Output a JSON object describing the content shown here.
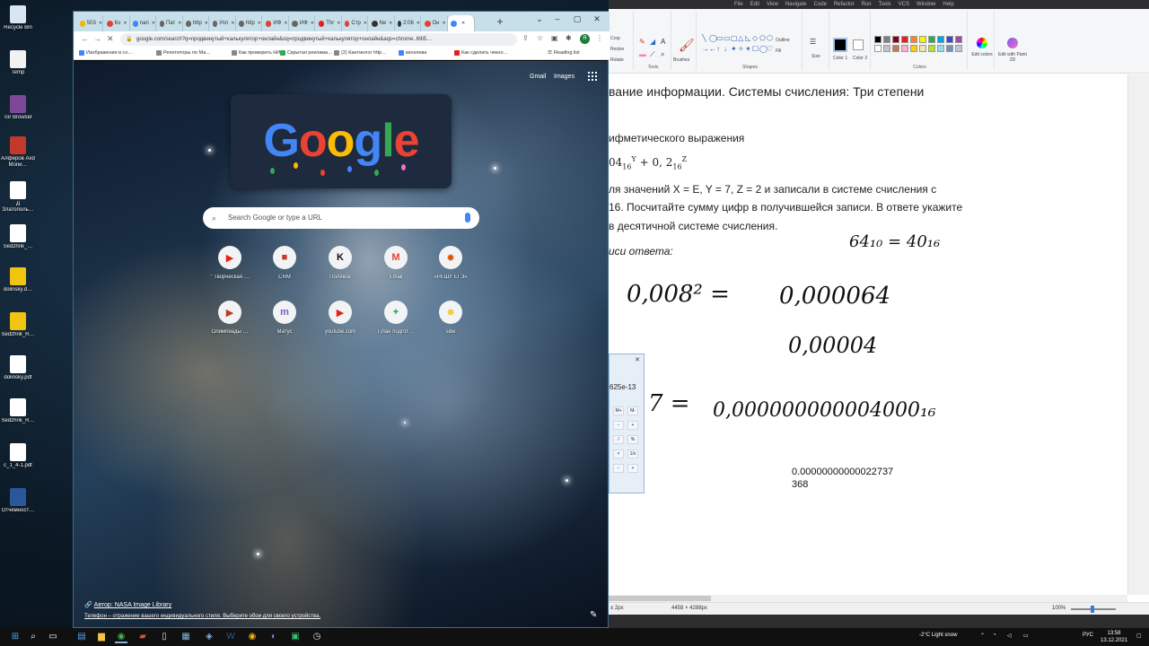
{
  "desktop": {
    "icons": [
      {
        "label": "Recycle Bin",
        "icon": "recycle-bin-icon",
        "color": "#d9e6f2"
      },
      {
        "label": "Temp",
        "icon": "text-file-icon",
        "color": "#f2f2f2"
      },
      {
        "label": "Tor Browser",
        "icon": "tor-icon",
        "color": "#7e4798"
      },
      {
        "label": "Алфёров Axd Monи…",
        "icon": "app-icon",
        "color": "#c0392b"
      },
      {
        "label": "Д Златополь…",
        "icon": "pdf-icon",
        "color": "#ffffff"
      },
      {
        "label": "Sedzhrik_…",
        "icon": "pdf-icon",
        "color": "#ffffff"
      },
      {
        "label": "dolinsky.d…",
        "icon": "text-file-icon",
        "color": "#f1c40f"
      },
      {
        "label": "Sedzhrik_R…",
        "icon": "text-file-icon",
        "color": "#f1c40f"
      },
      {
        "label": "dolinsky.pdf",
        "icon": "pdf-icon",
        "color": "#ffffff"
      },
      {
        "label": "Sedzhrik_R…",
        "icon": "pdf-icon",
        "color": "#ffffff"
      },
      {
        "label": "c_1_4-1.pdf",
        "icon": "pdf-icon",
        "color": "#ffffff"
      },
      {
        "label": "Отчёмност…",
        "icon": "word-icon",
        "color": "#2b579a"
      }
    ]
  },
  "chrome": {
    "tabs": [
      {
        "label": "503",
        "icon": "tab-favicon",
        "color": "#f4b400"
      },
      {
        "label": "Ко",
        "icon": "tab-favicon",
        "color": "#db4437"
      },
      {
        "label": "nan",
        "icon": "tab-favicon",
        "color": "#4285f4"
      },
      {
        "label": "Пат",
        "icon": "tab-favicon",
        "color": "#666666"
      },
      {
        "label": "http",
        "icon": "tab-favicon",
        "color": "#666666"
      },
      {
        "label": "Упл",
        "icon": "tab-favicon",
        "color": "#666666"
      },
      {
        "label": "http",
        "icon": "tab-favicon",
        "color": "#666666"
      },
      {
        "label": "ИФ",
        "icon": "tab-favicon",
        "color": "#db4437"
      },
      {
        "label": "ИФ",
        "icon": "tab-favicon",
        "color": "#666666"
      },
      {
        "label": "Thr",
        "icon": "tab-favicon",
        "color": "#e62117"
      },
      {
        "label": "Стр",
        "icon": "tab-favicon",
        "color": "#db4437"
      },
      {
        "label": "Ne",
        "icon": "tab-favicon",
        "color": "#333333"
      },
      {
        "label": "2:06",
        "icon": "tab-favicon",
        "color": "#333333"
      },
      {
        "label": "Он",
        "icon": "tab-favicon",
        "color": "#db4437"
      },
      {
        "label": "",
        "icon": "tab-favicon",
        "color": "#4285f4",
        "active": true
      }
    ],
    "url": "google.com/search?q=продвинутый+калькулятор+онлайн&oq=продвинутый+калькулятор+онлайн&aqs=chrome..69i5…",
    "bookmarks": [
      {
        "label": "Изображения в со…",
        "color": "#4285f4"
      },
      {
        "label": "Репетиторы по Ма…",
        "color": "#888888"
      },
      {
        "label": "Как проверить НИ…",
        "color": "#888888"
      },
      {
        "label": "Скрытая реклама…",
        "color": "#34a853"
      },
      {
        "label": "(2) Кантинлог http…",
        "color": "#888888"
      },
      {
        "label": "киселева",
        "color": "#4285f4"
      },
      {
        "label": "Как сделать чекно…",
        "color": "#e62117"
      }
    ],
    "reading_list": "Reading list",
    "ntp": {
      "gmail": "Gmail",
      "images": "Images",
      "doodle": {
        "letters": [
          "G",
          "o",
          "o",
          "g",
          "l",
          "e"
        ],
        "colors": [
          "#4285f4",
          "#ea4335",
          "#fbbc05",
          "#4285f4",
          "#34a853",
          "#ea4335"
        ]
      },
      "search_placeholder": "Search Google or type a URL",
      "shortcuts": [
        {
          "label": "\" Творческая …",
          "icon": "youtube-icon",
          "glyph": "▶",
          "color": "#e62117"
        },
        {
          "label": "CRM",
          "icon": "crm-icon",
          "glyph": "■",
          "color": "#c0392b"
        },
        {
          "label": "Полякое",
          "icon": "polyakov-icon",
          "glyph": "K",
          "color": "#111111"
        },
        {
          "label": "Email",
          "icon": "gmail-icon",
          "glyph": "M",
          "color": "#ea4335"
        },
        {
          "label": "«РЕШУ ЕГЭ»",
          "icon": "reshu-ege-icon",
          "glyph": "✹",
          "color": "#d35400"
        },
        {
          "label": "Олимпиады …",
          "icon": "olympiad-icon",
          "glyph": "▶",
          "color": "#c0392b"
        },
        {
          "label": "Матус",
          "icon": "matus-icon",
          "glyph": "m",
          "color": "#7b5fd0"
        },
        {
          "label": "youtube.com",
          "icon": "youtube-icon",
          "glyph": "▶",
          "color": "#e62117"
        },
        {
          "label": "План подгот…",
          "icon": "sheets-icon",
          "glyph": "+",
          "color": "#0f9d58"
        },
        {
          "label": "sibe",
          "icon": "sibe-icon",
          "glyph": "☻",
          "color": "#f4c542"
        }
      ],
      "credit_author": "Автор: NASA Image Library",
      "credit_text": "Телефон – отражение вашего индивидуального стиля. Выберите обои для своего устройства."
    }
  },
  "paint": {
    "menu": [
      "File",
      "Edit",
      "View",
      "Navigate",
      "Code",
      "Refactor",
      "Run",
      "Tools",
      "VCS",
      "Window",
      "Help"
    ],
    "ribbon": {
      "crop": "Crop",
      "resize": "Resize",
      "rotate": "Rotate",
      "tools": "Tools",
      "brushes": "Brushes",
      "shapes": "Shapes",
      "outline": "Outline",
      "fill": "Fill",
      "size": "Size",
      "color1": "Color 1",
      "color2": "Color 2",
      "colors": "Colors",
      "edit_colors": "Edit colors",
      "edit_paint3d": "Edit with Paint 3D"
    },
    "palette": [
      "#000000",
      "#7f7f7f",
      "#880015",
      "#ed1c24",
      "#ff7f27",
      "#fff200",
      "#22b14c",
      "#00a2e8",
      "#3f48cc",
      "#a349a4",
      "#ffffff",
      "#c3c3c3",
      "#b97a57",
      "#ffaec9",
      "#ffc90e",
      "#efe4b0",
      "#b5e61d",
      "#99d9ea",
      "#7092be",
      "#c8bfe7"
    ],
    "doc": {
      "title": "вание информации. Системы счисления: Три степени",
      "line1": "ифметического выражения",
      "line2": "04",
      "line2b": "+ 0, 2",
      "line3": "ля значений X = E, Y = 7, Z = 2 и записали в системе счисления с",
      "line4": "16. Посчитайте сумму цифр в получившейся записи. В ответе укажите",
      "line5": "в десятичной системе счисления.",
      "line6": "иси ответа:"
    },
    "handwriting": {
      "h1": "64₁₀ = 40₁₆",
      "h2": "0,008² =",
      "h3": "0,000064",
      "h4": "0,00004",
      "h5": "7 =",
      "h6": "0,000000000004000₁₆"
    },
    "calculator": {
      "display": "625e-13",
      "buttons": [
        "M+",
        "M-",
        "−",
        "+",
        "/",
        "%",
        "×",
        "1/x",
        "−",
        "+"
      ]
    },
    "result": {
      "line1": "0.00000000000022737",
      "line2": "368"
    },
    "status": {
      "size": "± 2px",
      "dims": "4458 × 4288px",
      "zoom": "100%"
    }
  },
  "taskbar": {
    "weather": "-2°C  Light snow",
    "lang": "РУС",
    "time": "13:58",
    "date": "13.12.2021"
  }
}
